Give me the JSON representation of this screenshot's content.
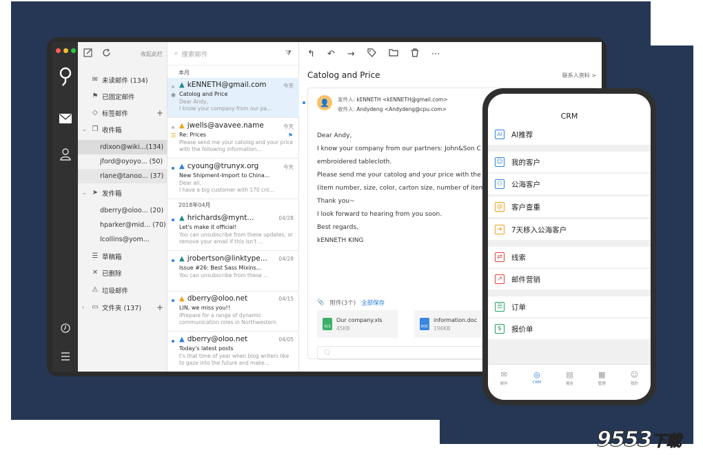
{
  "colors": {
    "background_frame": "#253754",
    "accent": "#2d7fe0",
    "rail": "#313131"
  },
  "toolbar": {
    "collapse_label": "收起此栏"
  },
  "folders": [
    {
      "icon": "envelope-icon",
      "label": "未读邮件 (134)"
    },
    {
      "icon": "pin-icon",
      "label": "已固定邮件"
    },
    {
      "icon": "tag-icon",
      "label": "标签邮件"
    },
    {
      "icon": "inbox-icon",
      "label": "收件箱"
    },
    {
      "icon": "",
      "label": "rdixon@wiki...(134)"
    },
    {
      "icon": "",
      "label": "jford@oyoyo... (50)"
    },
    {
      "icon": "",
      "label": "rlane@tanoo... (37)"
    },
    {
      "icon": "send-icon",
      "label": "发件箱"
    },
    {
      "icon": "",
      "label": "dberry@oloo... (20)"
    },
    {
      "icon": "",
      "label": "hparker@mid... (70)"
    },
    {
      "icon": "",
      "label": "lcollins@yom..."
    },
    {
      "icon": "draft-icon",
      "label": "草稿箱"
    },
    {
      "icon": "trash-icon",
      "label": "已删除"
    },
    {
      "icon": "spam-icon",
      "label": "垃圾邮件"
    },
    {
      "icon": "folder-icon",
      "label": "文件夹 (137)"
    }
  ],
  "search": {
    "placeholder": "搜索邮件"
  },
  "sections": {
    "this_month": "本月",
    "april": "2018年04月"
  },
  "mails": [
    {
      "from": "kENNETH@gmail.com",
      "date": "今天",
      "subject": "Catolog and  Price",
      "preview": "Dear Andy,\nI know your company from our pa..."
    },
    {
      "from": "jwells@avavee.name",
      "date": "今天",
      "subject": "Re: Prices",
      "preview": "Please send me your catolog and your price with the following information..."
    },
    {
      "from": "cyoung@trunyx.org",
      "date": "今天",
      "subject": "New Shipment-Import to China...",
      "preview": "Dear all,\nI have a big customer with 170 cnt..."
    },
    {
      "from": "hrichards@mynt...",
      "date": "04/28",
      "subject": "Let's make it official!",
      "preview": "You can unsubscribe from these updates, or remove your email if this isn't ..."
    },
    {
      "from": "jrobertson@linktype...",
      "date": "04/28",
      "subject": "Issue #26: Best Sass Mixins...",
      "preview": "You can unsubscribe from these ..."
    },
    {
      "from": "dberry@oloo.net",
      "date": "04/15",
      "subject": "LIN, we miss you!!",
      "preview": "IPrepare for a range of dynamic communication roles in Northwestern Univer..."
    },
    {
      "from": "dberry@oloo.net",
      "date": "04/05",
      "subject": "Today's latest posts",
      "preview": "t's that time of year when blog writers like to gaze into the future and make..."
    }
  ],
  "reader": {
    "title": "Catolog and  Price",
    "contact_link": "联系人资料 >",
    "sender_label": "发件人:",
    "sender": "kENNETH <kENNETH@gmail.com>",
    "recipient_label": "收件人:",
    "recipient": "Andydeng <Andydeng@cpu.com>",
    "body": [
      "Dear Andy,",
      "I know your company from our partners: John&Son C",
      "embroidered tablecloth.",
      "Please send me your catolog and your price with the f",
      "(item number, size, color, carton size, number of items",
      "Thank you~",
      "I look forward to hearing from you soon.",
      "Best regards,",
      "kENNETH KING"
    ],
    "attachments_label": "附件(3个)",
    "save_all": "全部保存",
    "files": [
      {
        "name": "Our company.xls",
        "size": "45KB",
        "type": "XLS"
      },
      {
        "name": "information.doc",
        "size": "196KB",
        "type": "DOC"
      }
    ]
  },
  "phone": {
    "title": "CRM",
    "items": [
      {
        "label": "AI推荐",
        "icon": "ai-icon",
        "color": "#2d7fe0"
      },
      {
        "label": "我的客户",
        "icon": "person-icon",
        "color": "#2d7fe0"
      },
      {
        "label": "公海客户",
        "icon": "people-icon",
        "color": "#2d7fe0"
      },
      {
        "label": "客户查重",
        "icon": "at-icon",
        "color": "#f0a020"
      },
      {
        "label": "7天移入公海客户",
        "icon": "arrow-icon",
        "color": "#f0a020"
      },
      {
        "label": "线索",
        "icon": "clue-icon",
        "color": "#e04040"
      },
      {
        "label": "邮件营销",
        "icon": "chart-icon",
        "color": "#e04040"
      },
      {
        "label": "订单",
        "icon": "order-icon",
        "color": "#20a060"
      },
      {
        "label": "报价单",
        "icon": "quote-icon",
        "color": "#20a060"
      }
    ],
    "tabs": [
      "邮件",
      "CRM",
      "报告",
      "管理",
      "我的"
    ]
  },
  "watermark": {
    "digits": "9553",
    "suffix": "下载"
  }
}
